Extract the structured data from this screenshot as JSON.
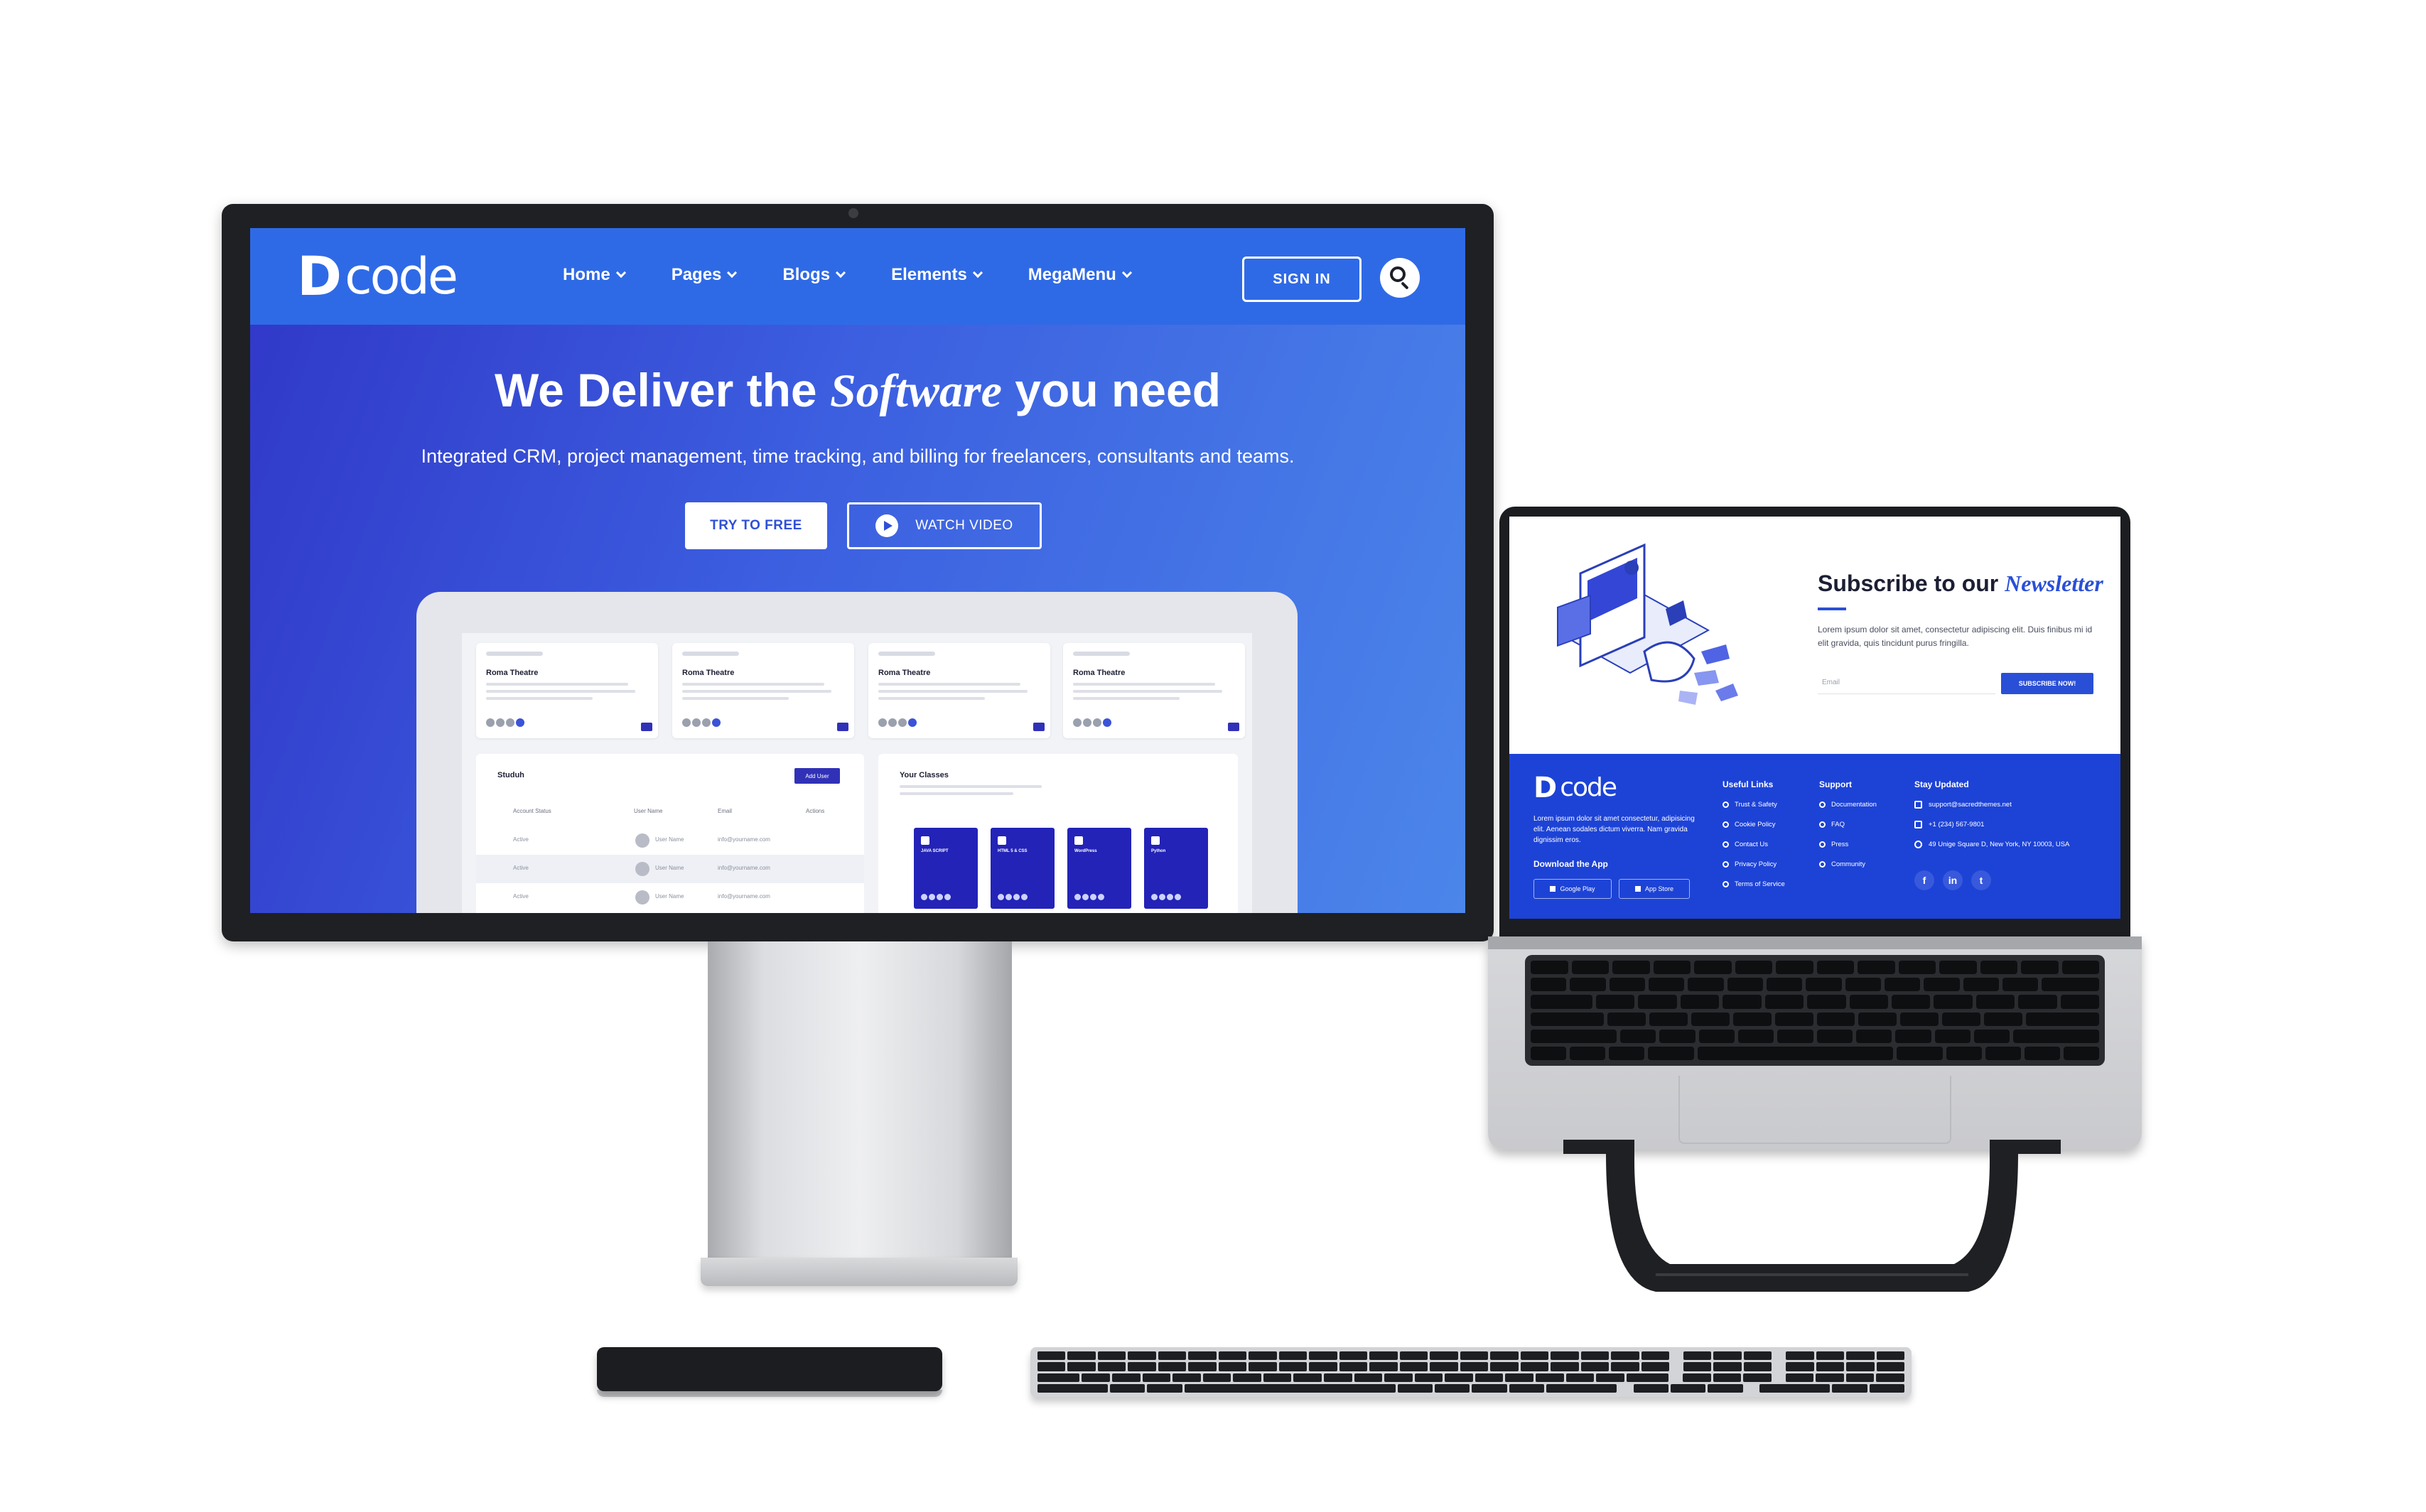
{
  "site": {
    "logo_mark": "D",
    "logo_word": "code",
    "nav": [
      {
        "label": "Home"
      },
      {
        "label": "Pages"
      },
      {
        "label": "Blogs"
      },
      {
        "label": "Elements"
      },
      {
        "label": "MegaMenu"
      }
    ],
    "signin_label": "SIGN IN",
    "hero": {
      "title_pre": "We Deliver the ",
      "title_em": "Software",
      "title_post": " you need",
      "subtitle": "Integrated CRM, project management, time tracking, and billing for freelancers, consultants and teams.",
      "try_label": "TRY TO FREE",
      "watch_label": "WATCH VIDEO"
    },
    "dashboard": {
      "card_title": "Roma Theatre",
      "students_title": "Studuh",
      "add_user_label": "Add User",
      "columns": [
        "Account Status",
        "User Name",
        "Email",
        "Actions"
      ],
      "rows": [
        {
          "status": "Active",
          "name": "User Name",
          "email": "info@yourname.com"
        },
        {
          "status": "Active",
          "name": "User Name",
          "email": "info@yourname.com"
        },
        {
          "status": "Active",
          "name": "User Name",
          "email": "info@yourname.com"
        }
      ],
      "classes_title": "Your Classes",
      "classes": [
        {
          "name": "JAVA SCRIPT"
        },
        {
          "name": "HTML 5 & CSS"
        },
        {
          "name": "WordPress"
        },
        {
          "name": "Python"
        }
      ]
    }
  },
  "newsletter": {
    "title_pre": "Subscribe to our ",
    "title_em": "Newsletter",
    "text": "Lorem ipsum dolor sit amet, consectetur adipiscing elit. Duis finibus mi id elit gravida, quis tincidunt purus fringilla.",
    "email_placeholder": "Email",
    "subscribe_label": "SUBSCRIBE NOW!"
  },
  "footer": {
    "logo_mark": "D",
    "logo_word": "code",
    "description": "Lorem ipsum dolor sit amet consectetur, adipisicing elit. Aenean sodales dictum viverra. Nam gravida dignissim eros.",
    "download_title": "Download the App",
    "google_play": "Google Play",
    "app_store": "App Store",
    "useful_links_title": "Useful Links",
    "useful_links": [
      "Trust & Safety",
      "Cookie Policy",
      "Contact Us",
      "Privacy Policy",
      "Terms of Service"
    ],
    "support_title": "Support",
    "support_links": [
      "Documentation",
      "FAQ",
      "Press",
      "Community"
    ],
    "stay_title": "Stay Updated",
    "email": "support@sacredthemes.net",
    "phone": "+1 (234) 567-9801",
    "address": "49 Unige Square D, New York, NY 10003, USA",
    "social": [
      "f",
      "in",
      "t"
    ]
  },
  "colors": {
    "brand_blue": "#2f6ae6",
    "footer_blue": "#1d43d6",
    "accent_blue": "#2a4fd7",
    "class_card": "#2323b8"
  }
}
